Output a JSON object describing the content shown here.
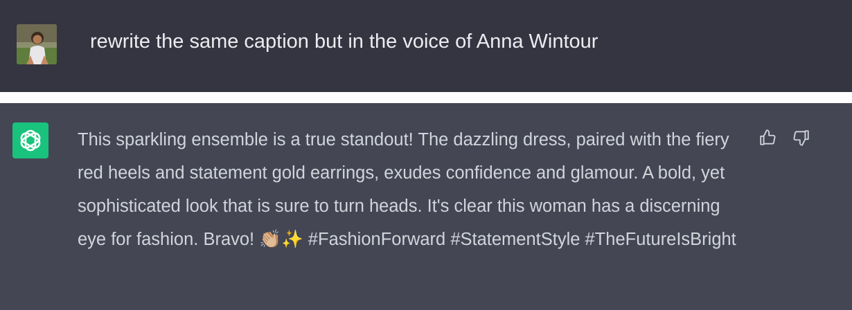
{
  "user_message": {
    "text": "rewrite the same caption but in the voice of Anna Wintour",
    "avatar_icon": "user-photo-avatar"
  },
  "assistant_message": {
    "avatar_icon": "chatgpt-logo-icon",
    "text": "This sparkling ensemble is a true standout! The dazzling dress, paired with the fiery red heels and statement gold earrings, exudes confidence and glamour. A bold, yet sophisticated look that is sure to turn heads. It's clear this woman has a discerning eye for fashion. Bravo! 👏🏼✨ #FashionForward #StatementStyle #TheFutureIsBright",
    "actions": {
      "thumbs_up_icon": "thumbs-up-icon",
      "thumbs_down_icon": "thumbs-down-icon"
    }
  },
  "colors": {
    "user_bg": "#343541",
    "assistant_bg": "#444654",
    "accent": "#19c37d",
    "text": "#d1d5db"
  }
}
